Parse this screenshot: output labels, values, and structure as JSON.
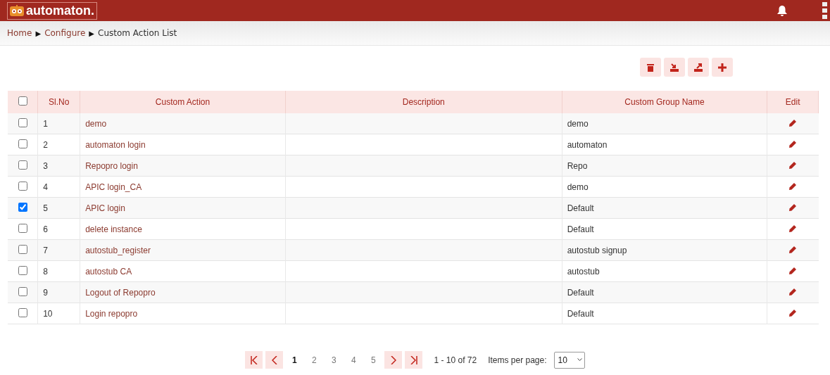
{
  "header": {
    "logo": "automaton."
  },
  "breadcrumb": [
    {
      "label": "Home",
      "link": true
    },
    {
      "label": "Configure",
      "link": true
    },
    {
      "label": "Custom Action List",
      "link": false
    }
  ],
  "breadcrumb_separator": "▶",
  "toolbar": [
    {
      "kind": "delete"
    },
    {
      "kind": "import"
    },
    {
      "kind": "export"
    },
    {
      "kind": "add"
    }
  ],
  "table": {
    "select_all": {
      "checked": false
    },
    "columns": [
      "Sl.No",
      "Custom Action",
      "Description",
      "Custom Group Name",
      "Edit"
    ],
    "rows": [
      {
        "checked": false,
        "no": "1",
        "action": "demo",
        "group": "demo"
      },
      {
        "checked": false,
        "no": "2",
        "action": "automaton login",
        "group": "automaton"
      },
      {
        "checked": false,
        "no": "3",
        "action": "Repopro login",
        "group": "Repo"
      },
      {
        "checked": false,
        "no": "4",
        "action": "APIC login_CA",
        "group": "demo"
      },
      {
        "checked": true,
        "no": "5",
        "action": "APIC login",
        "group": "Default"
      },
      {
        "checked": false,
        "no": "6",
        "action": "delete instance",
        "group": "Default"
      },
      {
        "checked": false,
        "no": "7",
        "action": "autostub_register",
        "group": "autostub signup"
      },
      {
        "checked": false,
        "no": "8",
        "action": "autostub CA",
        "group": "autostub"
      },
      {
        "checked": false,
        "no": "9",
        "action": "Logout of Repopro",
        "group": "Default"
      },
      {
        "checked": false,
        "no": "10",
        "action": "Login repopro",
        "group": "Default"
      }
    ]
  },
  "pagination": {
    "pages": [
      {
        "label": "1",
        "selected": true
      },
      {
        "label": "2",
        "selected": false
      },
      {
        "label": "3",
        "selected": false
      },
      {
        "label": "4",
        "selected": false
      },
      {
        "label": "5",
        "selected": false
      }
    ],
    "range": "1 - 10 of 72",
    "items_label": "Items per page:",
    "items_value": "10"
  }
}
